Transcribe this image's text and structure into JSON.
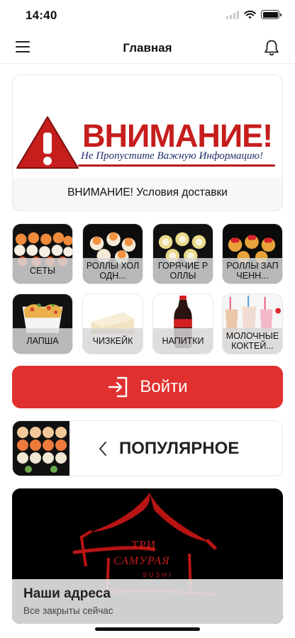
{
  "status": {
    "time": "14:40"
  },
  "nav": {
    "title": "Главная",
    "menu_icon": "hamburger-menu-icon",
    "bell_icon": "bell-icon"
  },
  "notice": {
    "banner_word": "ВНИМАНИЕ!",
    "banner_sub": "Не Пропустите Важную Информацию!",
    "caption": "ВНИМАНИЕ! Условия доставки",
    "accent_color": "#c61d1d"
  },
  "categories": [
    {
      "label": "СЕТЫ"
    },
    {
      "label": "РОЛЛЫ ХОЛОДН..."
    },
    {
      "label": "ГОРЯЧИЕ РОЛЛЫ"
    },
    {
      "label": "РОЛЛЫ ЗАПЧЕНН..."
    },
    {
      "label": "ЛАПША"
    },
    {
      "label": "ЧИЗКЕЙК"
    },
    {
      "label": "НАПИТКИ"
    },
    {
      "label": "МОЛОЧНЫЕ КОКТЕЙ..."
    }
  ],
  "login": {
    "label": "Войти",
    "color": "#e0302f"
  },
  "popular": {
    "label": "ПОПУЛЯРНОЕ"
  },
  "address": {
    "brand_line1": "ТРИ",
    "brand_line2": "САМУРАЯ",
    "brand_line3": "SUSHI",
    "title": "Наши адреса",
    "subtitle": "Все закрыты сейчас"
  }
}
